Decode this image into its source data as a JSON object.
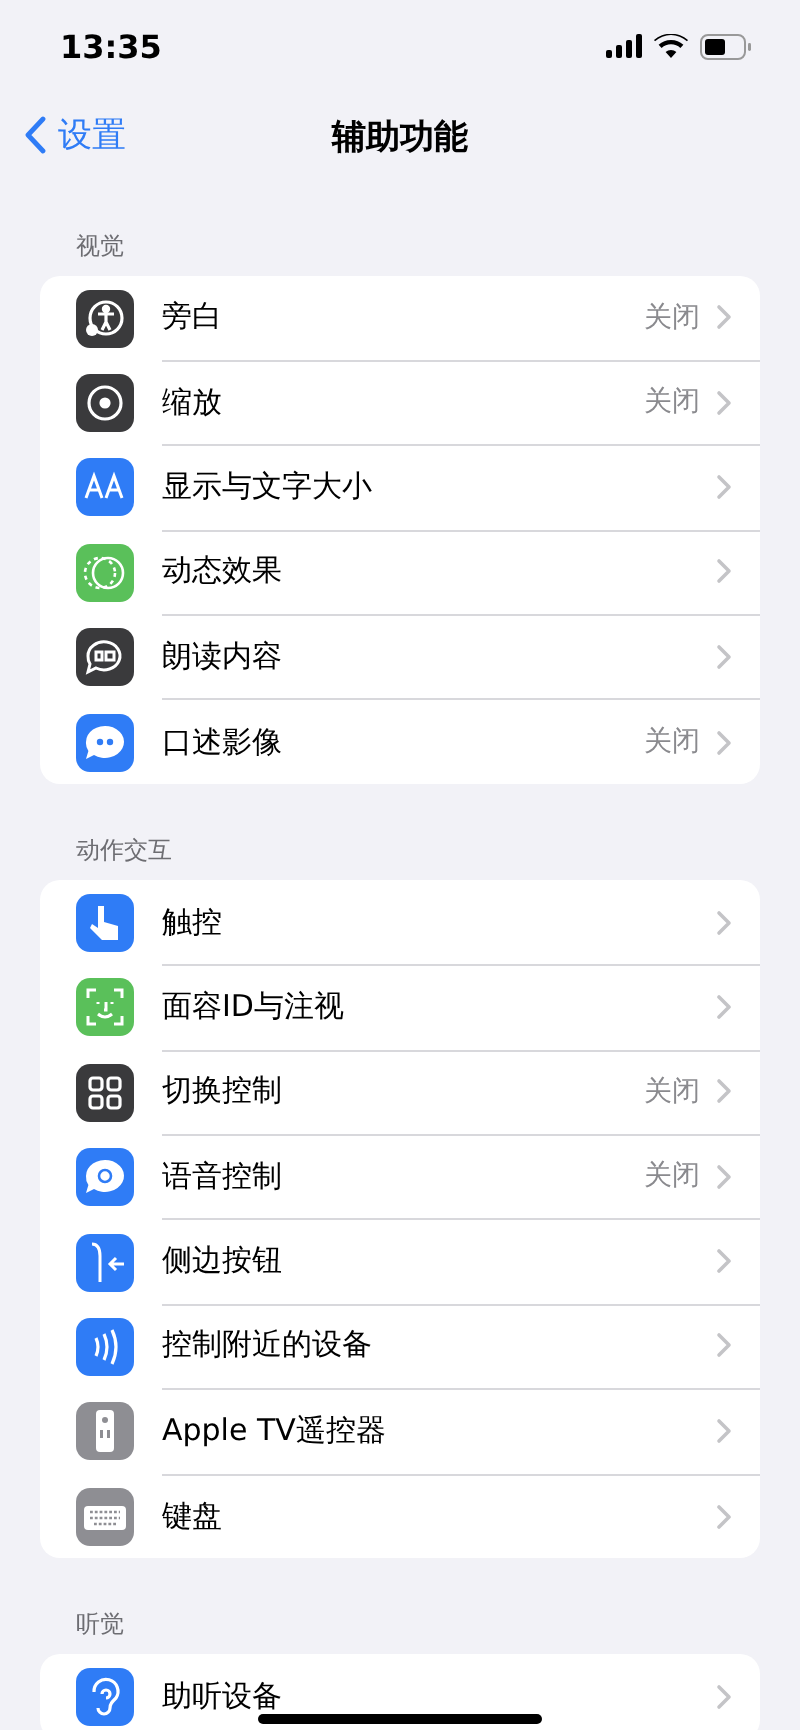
{
  "status_bar": {
    "time": "13:35"
  },
  "nav": {
    "back": "设置",
    "title": "辅助功能"
  },
  "sections": [
    {
      "header": "视觉",
      "rows": [
        {
          "label": "旁白",
          "value": "关闭",
          "color": "#3a3a3c"
        },
        {
          "label": "缩放",
          "value": "关闭",
          "color": "#3a3a3c"
        },
        {
          "label": "显示与文字大小",
          "color": "#2f7cf6"
        },
        {
          "label": "动态效果",
          "color": "#5ac05a"
        },
        {
          "label": "朗读内容",
          "color": "#3a3a3c"
        },
        {
          "label": "口述影像",
          "value": "关闭",
          "color": "#2f7cf6"
        }
      ]
    },
    {
      "header": "动作交互",
      "rows": [
        {
          "label": "触控",
          "color": "#2f7cf6"
        },
        {
          "label": "面容ID与注视",
          "color": "#5ac05a"
        },
        {
          "label": "切换控制",
          "value": "关闭",
          "color": "#3a3a3c"
        },
        {
          "label": "语音控制",
          "value": "关闭",
          "color": "#2f7cf6"
        },
        {
          "label": "侧边按钮",
          "color": "#2f7cf6"
        },
        {
          "label": "控制附近的设备",
          "color": "#2f7cf6"
        },
        {
          "label": "Apple TV遥控器",
          "color": "#8e8e93"
        },
        {
          "label": "键盘",
          "color": "#8e8e93"
        }
      ]
    },
    {
      "header": "听觉",
      "rows": [
        {
          "label": "助听设备",
          "color": "#2f7cf6"
        }
      ]
    }
  ]
}
